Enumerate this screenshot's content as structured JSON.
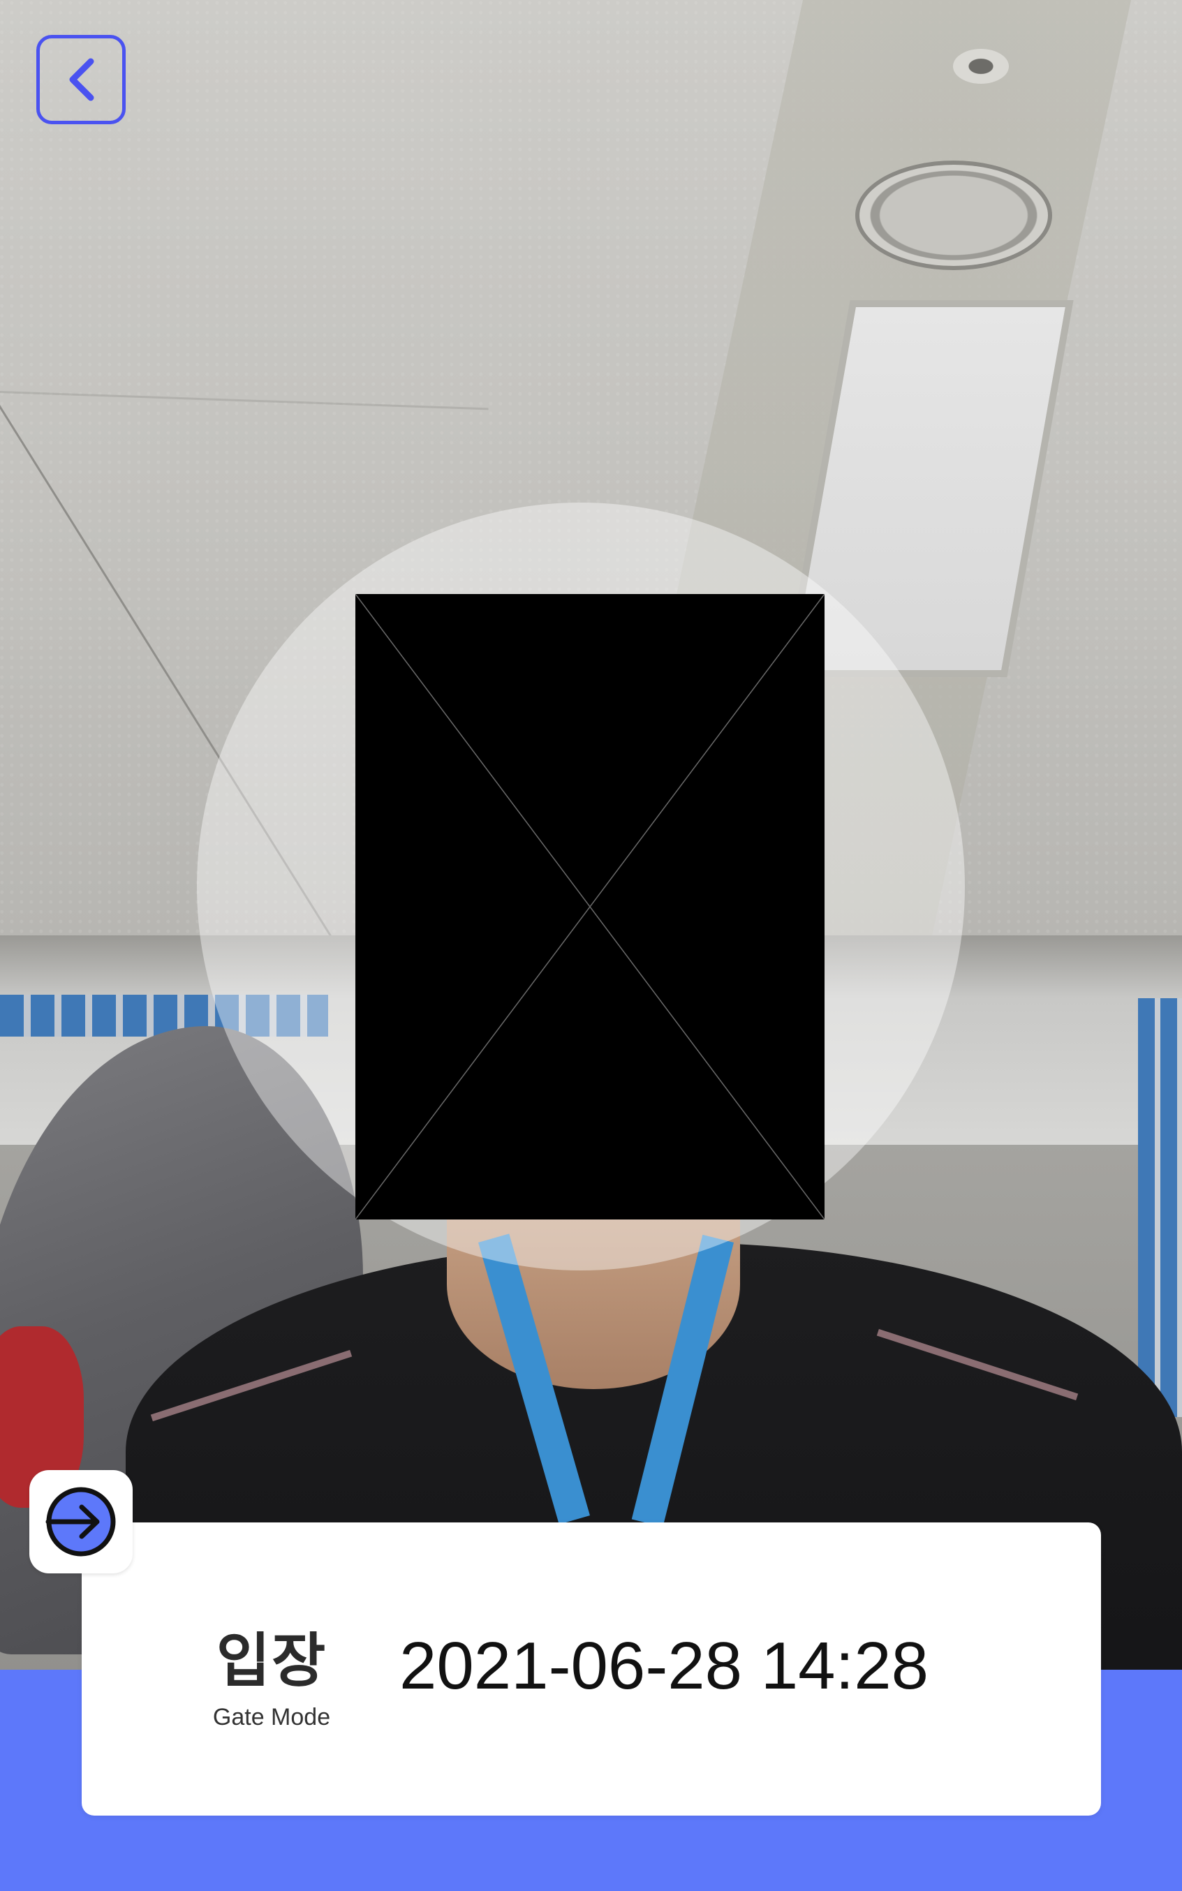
{
  "header": {
    "back_icon": "chevron-left-icon"
  },
  "gate": {
    "mode_title": "입장",
    "mode_subtitle": "Gate Mode",
    "datetime": "2021-06-28 14:28",
    "mode_icon": "arrow-right-circle-icon"
  },
  "colors": {
    "accent": "#4a52f0",
    "bottom_band": "#5d78fa",
    "icon_fill": "#5d78fa",
    "card": "#ffffff"
  }
}
